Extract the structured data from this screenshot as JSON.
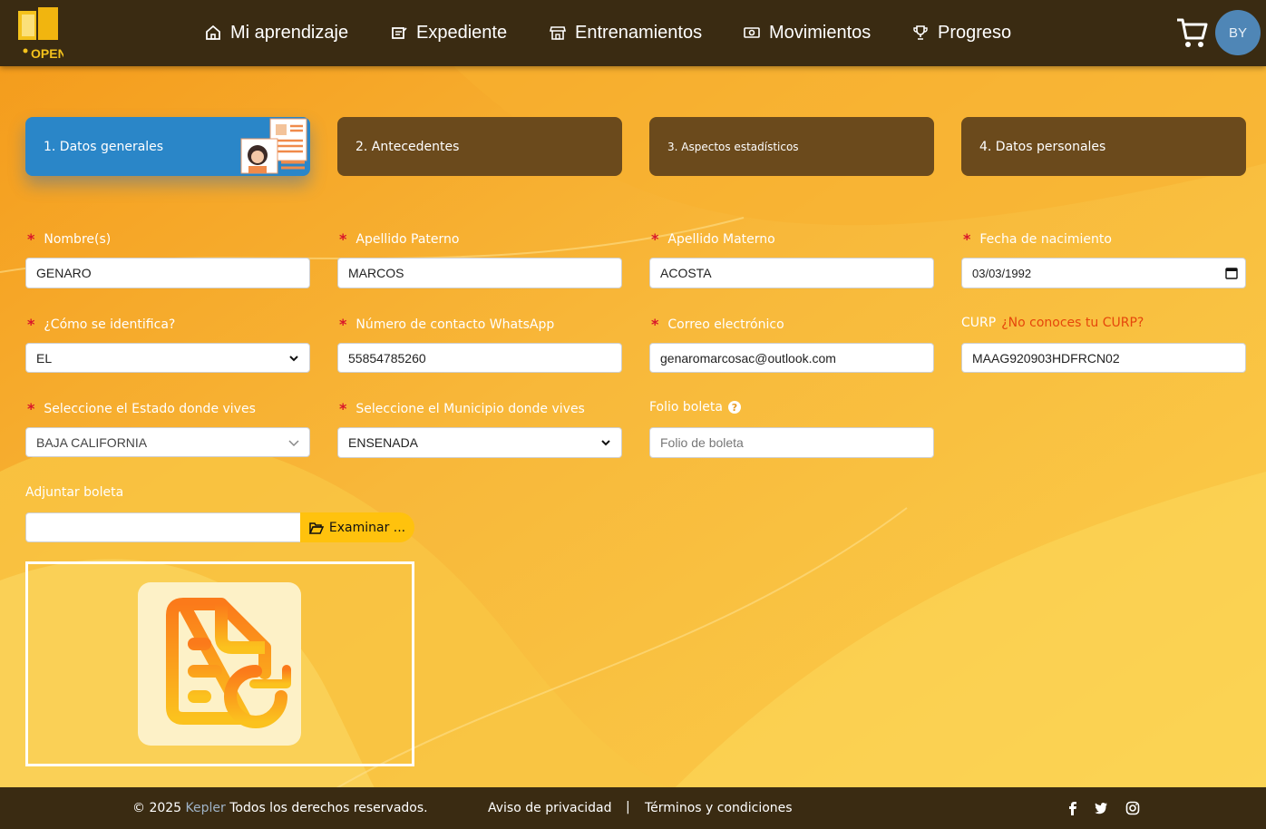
{
  "header": {
    "logo_alt": "OPEN",
    "nav": [
      {
        "label": "Mi aprendizaje",
        "icon": "home-icon"
      },
      {
        "label": "Expediente",
        "icon": "file-icon"
      },
      {
        "label": "Entrenamientos",
        "icon": "store-icon"
      },
      {
        "label": "Movimientos",
        "icon": "money-icon"
      },
      {
        "label": "Progreso",
        "icon": "trophy-icon"
      }
    ],
    "avatar_initials": "BY"
  },
  "steps": [
    {
      "label": "1. Datos generales",
      "active": true
    },
    {
      "label": "2. Antecedentes",
      "active": false
    },
    {
      "label": "3. Aspectos estadísticos",
      "active": false
    },
    {
      "label": "4. Datos personales",
      "active": false
    }
  ],
  "form": {
    "nombre": {
      "label": "Nombre(s)",
      "value": "GENARO"
    },
    "apellido_paterno": {
      "label": "Apellido Paterno",
      "value": "MARCOS"
    },
    "apellido_materno": {
      "label": "Apellido Materno",
      "value": "ACOSTA"
    },
    "fecha_nacimiento": {
      "label": "Fecha de nacimiento",
      "value": "03/03/1992"
    },
    "identifica": {
      "label": "¿Cómo se identifica?",
      "value": "EL"
    },
    "whatsapp": {
      "label": "Número de contacto WhatsApp",
      "value": "55854785260"
    },
    "correo": {
      "label": "Correo electrónico",
      "value": "genaromarcosac@outlook.com"
    },
    "curp": {
      "label": "CURP",
      "link": "¿No conoces tu CURP?",
      "value": "MAAG920903HDFRCN02"
    },
    "estado": {
      "label": "Seleccione el Estado donde vives",
      "value": "BAJA CALIFORNIA"
    },
    "municipio": {
      "label": "Seleccione el Municipio donde vives",
      "value": "ENSENADA"
    },
    "folio": {
      "label": "Folio boleta",
      "placeholder": "Folio de boleta"
    },
    "adjuntar": {
      "label": "Adjuntar boleta",
      "button": "Examinar ..."
    }
  },
  "footer": {
    "copyright_prefix": "© 2025",
    "brand": "Kepler",
    "copyright_suffix": "Todos los derechos reservados.",
    "privacy": "Aviso de privacidad",
    "separator": "|",
    "terms": "Términos y condiciones"
  },
  "colors": {
    "topbar": "#3a2b12",
    "step_active": "#2a86c8",
    "step_inactive": "#6b4a1c",
    "required": "#d9152b",
    "accent_button": "#ffc20d",
    "link": "#e5460b"
  }
}
